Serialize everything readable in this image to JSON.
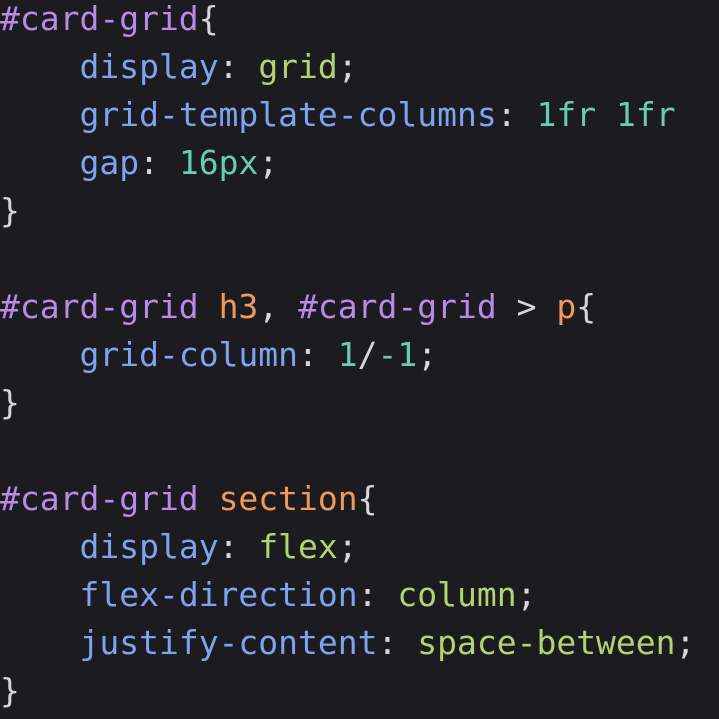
{
  "colors": {
    "background": "#1b1b20",
    "selector": "#b98ae6",
    "element": "#f09a5a",
    "property": "#7fa3ef",
    "keyword_value": "#b2d36f",
    "number": "#68cbb6",
    "punctuation": "#d6d6dc"
  },
  "code_lines": [
    [
      {
        "t": "#card-grid",
        "c": "sel"
      },
      {
        "t": "{",
        "c": "pun"
      }
    ],
    [
      {
        "t": "    ",
        "c": "pun"
      },
      {
        "t": "display",
        "c": "prop"
      },
      {
        "t": ": ",
        "c": "pun"
      },
      {
        "t": "grid",
        "c": "val"
      },
      {
        "t": ";",
        "c": "pun"
      }
    ],
    [
      {
        "t": "    ",
        "c": "pun"
      },
      {
        "t": "grid-template-columns",
        "c": "prop"
      },
      {
        "t": ": ",
        "c": "pun"
      },
      {
        "t": "1fr",
        "c": "num"
      },
      {
        "t": " ",
        "c": "pun"
      },
      {
        "t": "1fr",
        "c": "num"
      }
    ],
    [
      {
        "t": "    ",
        "c": "pun"
      },
      {
        "t": "gap",
        "c": "prop"
      },
      {
        "t": ": ",
        "c": "pun"
      },
      {
        "t": "16px",
        "c": "num"
      },
      {
        "t": ";",
        "c": "pun"
      }
    ],
    [
      {
        "t": "}",
        "c": "pun"
      }
    ],
    [],
    [
      {
        "t": "#card-grid",
        "c": "sel"
      },
      {
        "t": " ",
        "c": "pun"
      },
      {
        "t": "h3",
        "c": "tag"
      },
      {
        "t": ", ",
        "c": "pun"
      },
      {
        "t": "#card-grid",
        "c": "sel"
      },
      {
        "t": " > ",
        "c": "pun"
      },
      {
        "t": "p",
        "c": "tag"
      },
      {
        "t": "{",
        "c": "pun"
      }
    ],
    [
      {
        "t": "    ",
        "c": "pun"
      },
      {
        "t": "grid-column",
        "c": "prop"
      },
      {
        "t": ": ",
        "c": "pun"
      },
      {
        "t": "1",
        "c": "num"
      },
      {
        "t": "/",
        "c": "pun"
      },
      {
        "t": "-1",
        "c": "num"
      },
      {
        "t": ";",
        "c": "pun"
      }
    ],
    [
      {
        "t": "}",
        "c": "pun"
      }
    ],
    [],
    [
      {
        "t": "#card-grid",
        "c": "sel"
      },
      {
        "t": " ",
        "c": "pun"
      },
      {
        "t": "section",
        "c": "tag"
      },
      {
        "t": "{",
        "c": "pun"
      }
    ],
    [
      {
        "t": "    ",
        "c": "pun"
      },
      {
        "t": "display",
        "c": "prop"
      },
      {
        "t": ": ",
        "c": "pun"
      },
      {
        "t": "flex",
        "c": "val"
      },
      {
        "t": ";",
        "c": "pun"
      }
    ],
    [
      {
        "t": "    ",
        "c": "pun"
      },
      {
        "t": "flex-direction",
        "c": "prop"
      },
      {
        "t": ": ",
        "c": "pun"
      },
      {
        "t": "column",
        "c": "val"
      },
      {
        "t": ";",
        "c": "pun"
      }
    ],
    [
      {
        "t": "    ",
        "c": "pun"
      },
      {
        "t": "justify-content",
        "c": "prop"
      },
      {
        "t": ": ",
        "c": "pun"
      },
      {
        "t": "space-between",
        "c": "val"
      },
      {
        "t": ";",
        "c": "pun"
      }
    ],
    [
      {
        "t": "}",
        "c": "pun"
      }
    ]
  ]
}
